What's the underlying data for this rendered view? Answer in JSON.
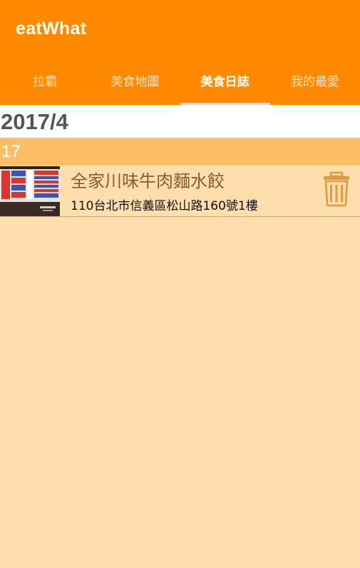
{
  "app": {
    "title": "eatWhat"
  },
  "tabs": [
    {
      "label": "拉霸"
    },
    {
      "label": "美食地圖"
    },
    {
      "label": "美食日誌"
    },
    {
      "label": "我的最愛"
    }
  ],
  "active_tab": "美食日誌",
  "log": {
    "month": "2017/4",
    "day": "17",
    "entries": [
      {
        "name": "全家川味牛肉麵水餃",
        "address": "110台北市信義區松山路160號1樓"
      }
    ]
  },
  "icons": {
    "delete": "trash-icon",
    "thumbnail": "menu-board-photo"
  },
  "colors": {
    "appbar": "#FF8A00",
    "background": "#FFDEAD",
    "day_header": "#FFBD66",
    "delete_icon": "#E39A3C",
    "entry_name": "#8B5A2B"
  }
}
